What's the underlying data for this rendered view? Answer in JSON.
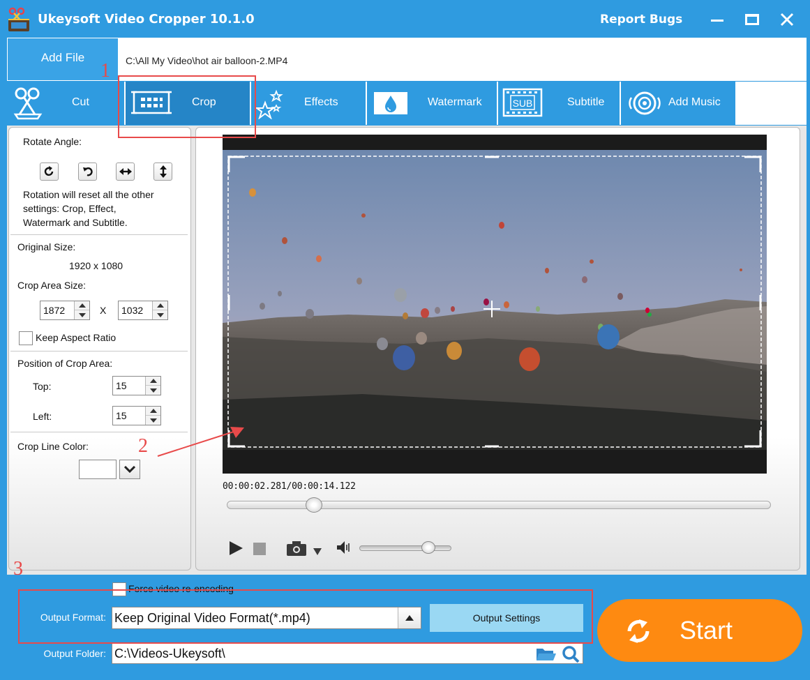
{
  "window": {
    "title": "Ukeysoft Video Cropper 10.1.0",
    "report_bugs": "Report Bugs"
  },
  "filebar": {
    "add_file": "Add File",
    "path": "C:\\All My Video\\hot air balloon-2.MP4"
  },
  "tabs": [
    {
      "label": "Cut",
      "icon": "scissors-icon"
    },
    {
      "label": "Crop",
      "icon": "crop-frame-icon",
      "active": true
    },
    {
      "label": "Effects",
      "icon": "stars-icon"
    },
    {
      "label": "Watermark",
      "icon": "drop-icon"
    },
    {
      "label": "Subtitle",
      "icon": "sub-film-icon",
      "icon_text": "SUB"
    },
    {
      "label": "Add Music",
      "icon": "music-disc-icon"
    }
  ],
  "crop_panel": {
    "rotate_label": "Rotate Angle:",
    "rotate_note_1": "Rotation will reset all the other",
    "rotate_note_2": "settings: Crop, Effect,",
    "rotate_note_3": "Watermark and Subtitle.",
    "original_size_label": "Original Size:",
    "original_size_value": "1920 x 1080",
    "crop_area_label": "Crop Area Size:",
    "crop_width": "1872",
    "crop_sep": "X",
    "crop_height": "1032",
    "keep_aspect": "Keep Aspect Ratio",
    "position_label": "Position of Crop Area:",
    "top_label": "Top:",
    "top_value": "15",
    "left_label": "Left:",
    "left_value": "15",
    "line_color_label": "Crop Line Color:",
    "line_color": "#ffffff"
  },
  "player": {
    "time_current": "00:00:02.281",
    "time_sep": "/",
    "time_total": "00:00:14.122",
    "seek_fraction": 0.16,
    "volume_fraction": 0.75
  },
  "output": {
    "force_reencode": "Force video re-encoding",
    "format_label": "Output Format:",
    "format_value": "Keep Original Video Format(*.mp4)",
    "settings_button": "Output Settings",
    "folder_label": "Output Folder:",
    "folder_value": "C:\\Videos-Ukeysoft\\",
    "start_label": "Start"
  },
  "annotations": {
    "n1": "1",
    "n2": "2",
    "n3": "3"
  },
  "colors": {
    "brand_blue": "#2f9be0",
    "start_orange": "#fe8a11",
    "annotation_red": "#e84a4a"
  }
}
